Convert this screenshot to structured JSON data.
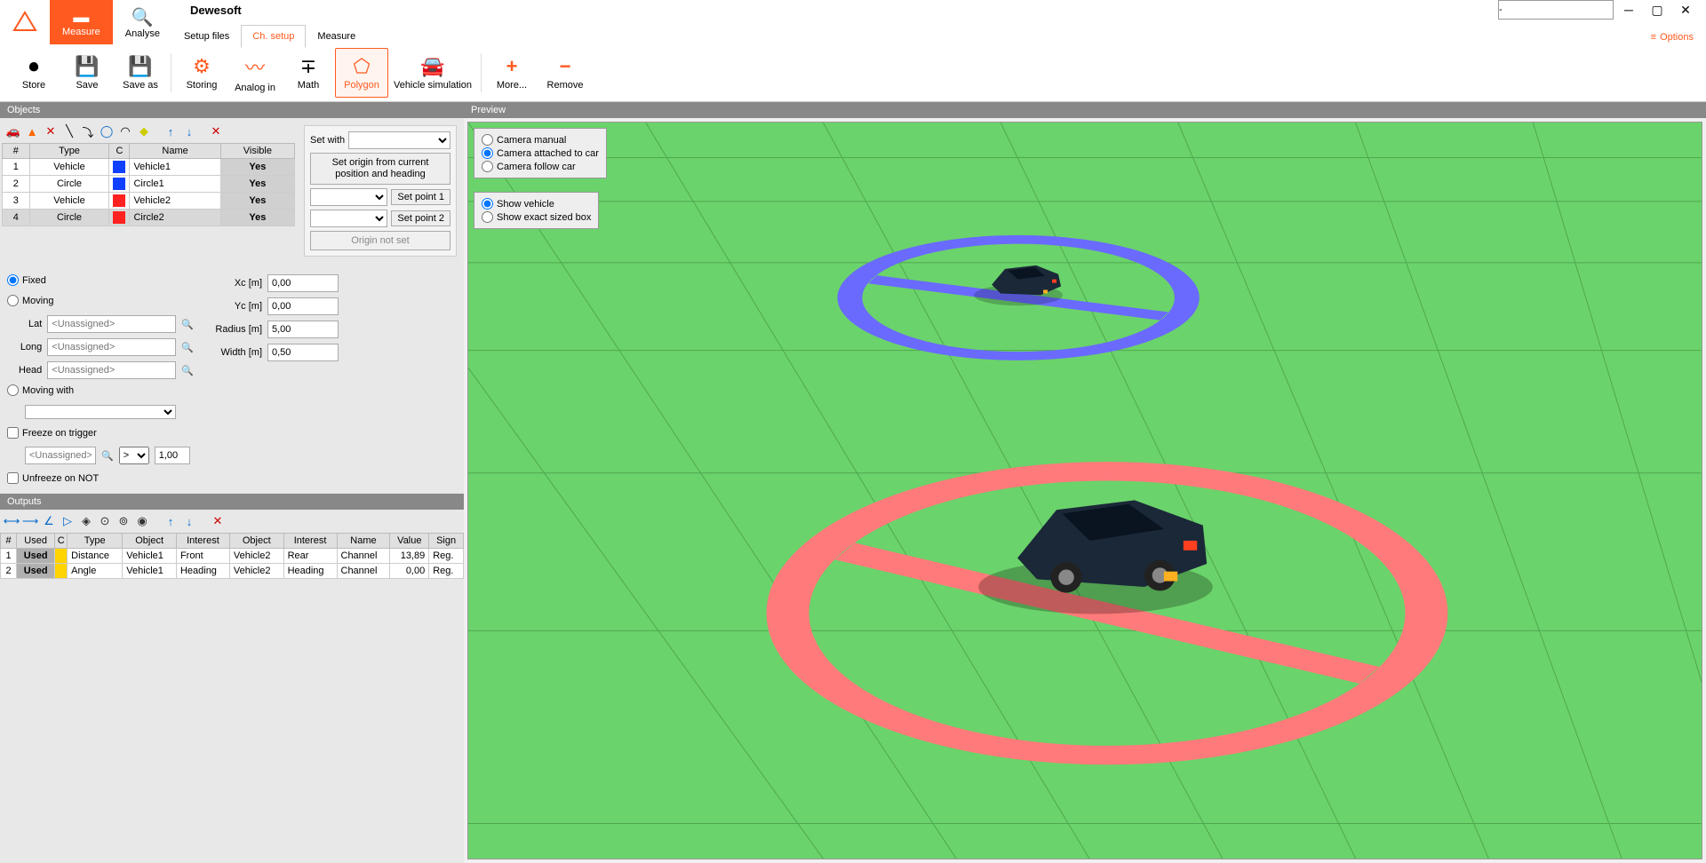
{
  "app": {
    "title": "Dewesoft"
  },
  "mainTabs": {
    "measure": "Measure",
    "analyse": "Analyse"
  },
  "subTabs": {
    "setupFiles": "Setup files",
    "chSetup": "Ch. setup",
    "measure": "Measure"
  },
  "options": "Options",
  "winInput": "-",
  "toolbar": {
    "store": "Store",
    "save": "Save",
    "saveAs": "Save as",
    "storing": "Storing",
    "analogIn": "Analog in",
    "math": "Math",
    "polygon": "Polygon",
    "vehicleSim": "Vehicle simulation",
    "more": "More...",
    "remove": "Remove"
  },
  "panels": {
    "objects": "Objects",
    "preview": "Preview",
    "outputs": "Outputs"
  },
  "objTable": {
    "headers": {
      "num": "#",
      "type": "Type",
      "c": "C",
      "name": "Name",
      "visible": "Visible"
    },
    "rows": [
      {
        "n": "1",
        "type": "Vehicle",
        "color": "#1040ff",
        "name": "Vehicle1",
        "visible": "Yes"
      },
      {
        "n": "2",
        "type": "Circle",
        "color": "#1040ff",
        "name": "Circle1",
        "visible": "Yes"
      },
      {
        "n": "3",
        "type": "Vehicle",
        "color": "#ff2020",
        "name": "Vehicle2",
        "visible": "Yes"
      },
      {
        "n": "4",
        "type": "Circle",
        "color": "#ff2020",
        "name": "Circle2",
        "visible": "Yes"
      }
    ]
  },
  "setOrigin": {
    "setWith": "Set with",
    "fromPos": "Set origin from current position and heading",
    "setPoint1": "Set point 1",
    "setPoint2": "Set point 2",
    "notSet": "Origin not set"
  },
  "position": {
    "fixed": "Fixed",
    "moving": "Moving",
    "movingWith": "Moving with",
    "lat": "Lat",
    "long": "Long",
    "head": "Head",
    "unassigned": "<Unassigned>",
    "freeze": "Freeze on trigger",
    "unfreeze": "Unfreeze on NOT",
    "gt": ">",
    "val100": "1,00"
  },
  "geom": {
    "xc": "Xc [m]",
    "yc": "Yc [m]",
    "radius": "Radius [m]",
    "width": "Width [m]",
    "xcVal": "0,00",
    "ycVal": "0,00",
    "radiusVal": "5,00",
    "widthVal": "0,50"
  },
  "camera": {
    "manual": "Camera manual",
    "attached": "Camera attached to car",
    "follow": "Camera follow car",
    "showVehicle": "Show vehicle",
    "showBox": "Show exact sized box"
  },
  "outTable": {
    "headers": {
      "num": "#",
      "used": "Used",
      "c": "C",
      "type": "Type",
      "object1": "Object",
      "interest1": "Interest",
      "object2": "Object",
      "interest2": "Interest",
      "name": "Name",
      "value": "Value",
      "sign": "Sign"
    },
    "rows": [
      {
        "n": "1",
        "used": "Used",
        "type": "Distance",
        "obj1": "Vehicle1",
        "int1": "Front",
        "obj2": "Vehicle2",
        "int2": "Rear",
        "name": "Channel",
        "value": "13,89",
        "sign": "Reg."
      },
      {
        "n": "2",
        "used": "Used",
        "type": "Angle",
        "obj1": "Vehicle1",
        "int1": "Heading",
        "obj2": "Vehicle2",
        "int2": "Heading",
        "name": "Channel",
        "value": "0,00",
        "sign": "Reg."
      }
    ]
  }
}
